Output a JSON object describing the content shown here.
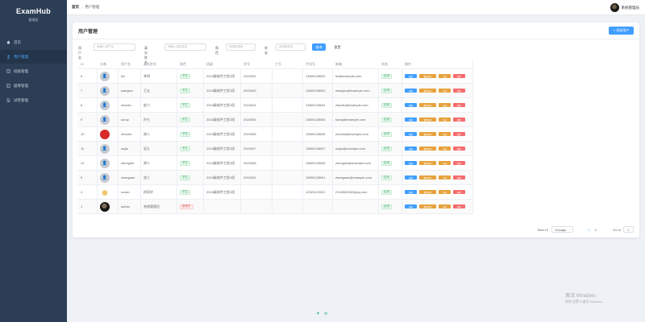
{
  "app": {
    "name": "ExamHub",
    "subtitle": "管理员"
  },
  "sidebar": {
    "items": [
      {
        "label": "首页",
        "icon": "home-icon"
      },
      {
        "label": "用户管理",
        "icon": "user-icon",
        "active": true
      },
      {
        "label": "班级管理",
        "icon": "building-icon"
      },
      {
        "label": "题库管理",
        "icon": "book-icon"
      },
      {
        "label": "试卷管理",
        "icon": "document-icon"
      }
    ]
  },
  "header": {
    "breadcrumb": {
      "home": "首页",
      "sep": "/",
      "current": "用户管理"
    },
    "username": "系统管理员"
  },
  "page": {
    "title": "用户管理",
    "add_button": "+ 添加用户"
  },
  "filters": {
    "username_label": "用户名",
    "username_placeholder": "请输入用户名",
    "realname_label": "真实姓名",
    "realname_placeholder": "请输入真实姓名",
    "role_label": "角色",
    "role_placeholder": "请选择角色",
    "status_label": "状态",
    "status_placeholder": "请选择状态",
    "query_button": "查询",
    "reset_button": "重置"
  },
  "table": {
    "columns": [
      "ID",
      "头像",
      "用户名",
      "真实姓名",
      "角色",
      "班级",
      "学号",
      "工号",
      "手机号",
      "邮箱",
      "状态",
      "操作"
    ],
    "op_labels": {
      "edit": "编辑",
      "reset": "重置密码",
      "freeze": "冻结",
      "delete": "删除"
    },
    "rows": [
      {
        "id": "6",
        "avatar": "default",
        "username": "lisi",
        "realname": "李四",
        "role": "学生",
        "role_type": "green",
        "class": "2024级软件工程1班",
        "student_no": "2024002",
        "staff_no": "",
        "phone": "13800138002",
        "email": "lisi@example.com",
        "status": "启用"
      },
      {
        "id": "7",
        "avatar": "default",
        "username": "wangwu",
        "realname": "王五",
        "role": "学生",
        "role_type": "green",
        "class": "2024级软件工程1班",
        "student_no": "2024003",
        "staff_no": "",
        "phone": "13800138003",
        "email": "wangwu@example.com",
        "status": "启用"
      },
      {
        "id": "8",
        "avatar": "default",
        "username": "zhaoliu",
        "realname": "赵六",
        "role": "学生",
        "role_type": "green",
        "class": "2024级软件工程1班",
        "student_no": "2024004",
        "staff_no": "",
        "phone": "13800138004",
        "email": "zhaoliu@example.com",
        "status": "启用"
      },
      {
        "id": "9",
        "avatar": "default",
        "username": "sunqi",
        "realname": "孙七",
        "role": "学生",
        "role_type": "green",
        "class": "2024级软件工程1班",
        "student_no": "2024005",
        "staff_no": "",
        "phone": "13800138005",
        "email": "sunqi@example.com",
        "status": "启用"
      },
      {
        "id": "10",
        "avatar": "red",
        "username": "zhouba",
        "realname": "周八",
        "role": "学生",
        "role_type": "green",
        "class": "2024级软件工程1班",
        "student_no": "2024006",
        "staff_no": "",
        "phone": "13800138006",
        "email": "zhouba@example.com",
        "status": "启用"
      },
      {
        "id": "11",
        "avatar": "default",
        "username": "wujiu",
        "realname": "吴九",
        "role": "学生",
        "role_type": "green",
        "class": "2024级软件工程1班",
        "student_no": "2024007",
        "staff_no": "",
        "phone": "13800138007",
        "email": "wujiu@example.com",
        "status": "启用"
      },
      {
        "id": "12",
        "avatar": "default",
        "username": "zhengshi",
        "realname": "郑十",
        "role": "学生",
        "role_type": "green",
        "class": "2024级软件工程1班",
        "student_no": "2024008",
        "staff_no": "",
        "phone": "13800138008",
        "email": "zhengshi@example.com",
        "status": "启用"
      },
      {
        "id": "5",
        "avatar": "default",
        "username": "zhangsan",
        "realname": "张三",
        "role": "学生",
        "role_type": "green",
        "class": "2024级软件工程1班",
        "student_no": "2024001",
        "staff_no": "",
        "phone": "13800138001",
        "email": "zhangsan@example.com",
        "status": "启用"
      },
      {
        "id": "4",
        "avatar": "dog",
        "username": "xusan",
        "realname": "徐同学",
        "role": "学生",
        "role_type": "green",
        "class": "2024级软件工程1班",
        "student_no": "",
        "staff_no": "",
        "phone": "12323123321",
        "email": "2134565432@qq.com",
        "status": "启用"
      },
      {
        "id": "1",
        "avatar": "dark",
        "username": "admin",
        "realname": "系统管理员",
        "role": "管理员",
        "role_type": "red",
        "class": "",
        "student_no": "",
        "staff_no": "",
        "phone": "",
        "email": "",
        "status": "启用"
      }
    ]
  },
  "pagination": {
    "total": "Total 12",
    "page_size": "10/page",
    "prev": "‹",
    "pages": [
      "1",
      "2"
    ],
    "active_page": "1",
    "next": "›",
    "goto_label": "Go to",
    "goto_value": "1"
  },
  "watermark": {
    "line1": "激活 Windows",
    "line2": "转到\"设置\"以激活 Windows。"
  },
  "colors": {
    "sidebar": "#2b3e55",
    "primary": "#409eff",
    "warning": "#e6a23c",
    "danger": "#f56c6c",
    "success": "#47b36f"
  }
}
